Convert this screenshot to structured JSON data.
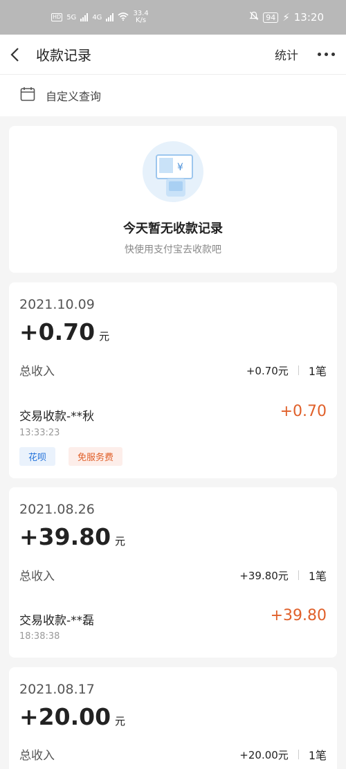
{
  "status_bar": {
    "hd_label": "HD",
    "sim1_label": "5G",
    "sim2_label": "4G",
    "net_speed": "33.4",
    "net_unit": "K/s",
    "battery": "94",
    "time": "13:20"
  },
  "navbar": {
    "title": "收款记录",
    "stats_label": "统计"
  },
  "query": {
    "label": "自定义查询"
  },
  "empty": {
    "title": "今天暂无收款记录",
    "subtitle": "快使用支付宝去收款吧",
    "illus_symbol": "¥"
  },
  "records": [
    {
      "date": "2021.10.09",
      "amount": "+0.70",
      "unit": "元",
      "income_label": "总收入",
      "income_value": "+0.70元",
      "count": "1笔",
      "txn_name": "交易收款-**秋",
      "txn_amount": "+0.70",
      "txn_time": "13:33:23",
      "tags": [
        "花呗",
        "免服务费"
      ]
    },
    {
      "date": "2021.08.26",
      "amount": "+39.80",
      "unit": "元",
      "income_label": "总收入",
      "income_value": "+39.80元",
      "count": "1笔",
      "txn_name": "交易收款-**磊",
      "txn_amount": "+39.80",
      "txn_time": "18:38:38"
    },
    {
      "date": "2021.08.17",
      "amount": "+20.00",
      "unit": "元",
      "income_label": "总收入",
      "income_value": "+20.00元",
      "count": "1笔"
    }
  ],
  "colors": {
    "accent_orange": "#e0602a",
    "tag_blue": "#1e6fd9"
  }
}
